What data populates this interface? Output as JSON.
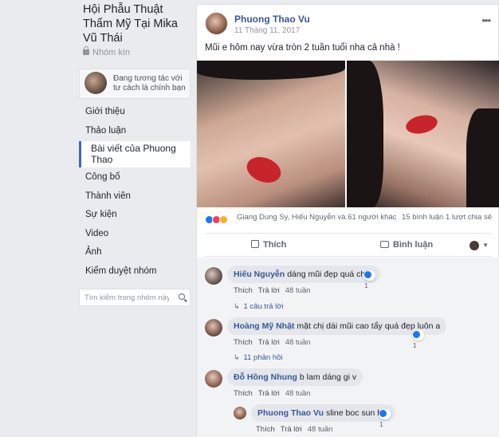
{
  "group": {
    "title": "Hội Phẫu Thuật Thẩm Mỹ Tại Mika Vũ Thái",
    "privacy": "Nhóm kín",
    "acting_as": "Đang tương tác với tư cách là chính bạn"
  },
  "nav": {
    "items": [
      {
        "label": "Giới thiệu"
      },
      {
        "label": "Thảo luận"
      },
      {
        "label": "Bài viết của Phuong Thao"
      },
      {
        "label": "Công bố"
      },
      {
        "label": "Thành viên"
      },
      {
        "label": "Sự kiện"
      },
      {
        "label": "Video"
      },
      {
        "label": "Ảnh"
      },
      {
        "label": "Kiểm duyệt nhóm"
      }
    ],
    "search_placeholder": "Tìm kiếm trong nhóm này"
  },
  "post": {
    "author": "Phuong Thao Vu",
    "time": "11 Tháng 11, 2017",
    "text": "Mũi e hôm nay vừa tròn 2 tuần tuổi nha cả nhà !",
    "reactions_text": "Giang Dung Sy, Hiếu Nguyễn và 61 người khác",
    "counts_text": "15 bình luận  1 lượt chia sẻ",
    "like_label": "Thích",
    "comment_label": "Bình luận"
  },
  "comments": [
    {
      "name": "Hiếu Nguyễn",
      "text": "dáng mũi đẹp quá chị ạ",
      "reactions": "1",
      "like": "Thích",
      "reply": "Trả lời",
      "time": "48 tuần",
      "replies_link": "1 câu trả lời"
    },
    {
      "name": "Hoàng Mỹ Nhật",
      "text": "mặt chị dài mũi cao tẩy quá đẹp luôn a",
      "reactions": "1",
      "like": "Thích",
      "reply": "Trả lời",
      "time": "48 tuần",
      "replies_link": "11 phản hồi"
    },
    {
      "name": "Đỗ Hồng Nhung",
      "text": "b lam dáng gi v",
      "like": "Thích",
      "reply": "Trả lời",
      "time": "48 tuần"
    },
    {
      "name": "Phuong Thao Vu",
      "text": "sline boc sun b a",
      "reactions": "1",
      "like": "Thích",
      "reply": "Trả lời",
      "time": "48 tuần"
    }
  ],
  "colors": {
    "link": "#365899",
    "accent": "#4267b2",
    "lips": "#c8242b"
  }
}
